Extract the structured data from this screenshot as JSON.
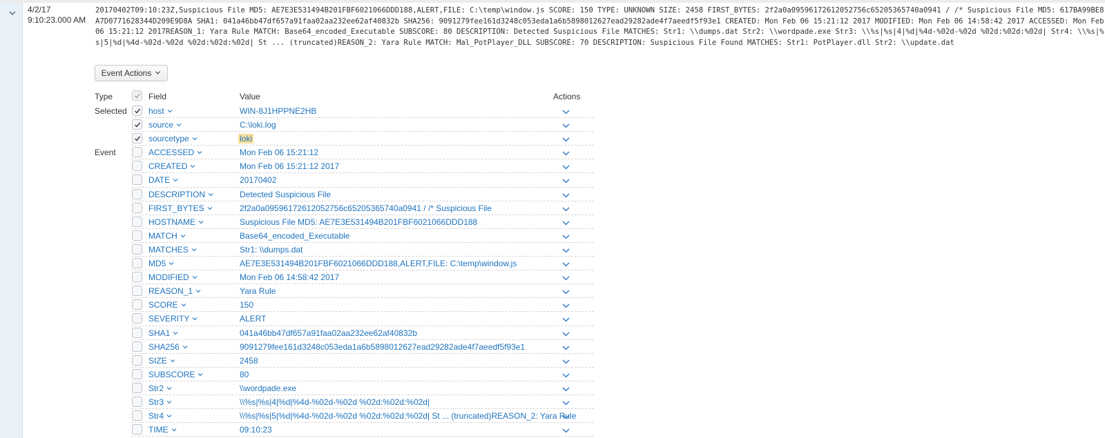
{
  "event": {
    "date": "4/2/17",
    "time": "9:10:23.000 AM",
    "raw": "20170402T09:10:23Z,Suspicious File MD5: AE7E3E531494B201FBF6021066DDD188,ALERT,FILE: C:\\temp\\window.js SCORE: 150 TYPE: UNKNOWN SIZE: 2458 FIRST_BYTES: 2f2a0a09596172612052756c65205365740a0941 / /* Suspicious File MD5: 617BA99BE8A7D0771628344D209E9D8A SHA1: 041a46bb47df657a91faa02aa232ee62af40832b SHA256: 9091279fee161d3248c053eda1a6b5898012627ead29282ade4f7aeedf5f93e1 CREATED: Mon Feb 06 15:21:12 2017 MODIFIED: Mon Feb 06 14:58:42 2017 ACCESSED: Mon Feb 06 15:21:12 2017REASON_1: Yara Rule MATCH: Base64_encoded_Executable SUBSCORE: 80 DESCRIPTION: Detected Suspicious File MATCHES: Str1: \\\\dumps.dat Str2: \\\\wordpade.exe Str3: \\\\%s|%s|4|%d|%4d-%02d-%02d %02d:%02d:%02d| Str4: \\\\%s|%s|5|%d|%4d-%02d-%02d %02d:%02d:%02d| St ... (truncated)REASON_2: Yara Rule MATCH: Mal_PotPlayer_DLL SUBSCORE: 70 DESCRIPTION: Suspicious File Found MATCHES: Str1: PotPlayer.dll Str2: \\\\update.dat"
  },
  "event_actions_label": "Event Actions",
  "table": {
    "headers": {
      "type": "Type",
      "field": "Field",
      "value": "Value",
      "actions": "Actions"
    },
    "rows": [
      {
        "group": "Selected",
        "field": "host",
        "value": "WIN-8J1HPPNE2HB",
        "checked": true,
        "highlight": false
      },
      {
        "group": "",
        "field": "source",
        "value": "C:\\loki.log",
        "checked": true,
        "highlight": false
      },
      {
        "group": "",
        "field": "sourcetype",
        "value": "loki",
        "checked": true,
        "highlight": true
      },
      {
        "group": "Event",
        "field": "ACCESSED",
        "value": "Mon Feb 06 15:21:12",
        "checked": false,
        "highlight": false
      },
      {
        "group": "",
        "field": "CREATED",
        "value": "Mon Feb 06 15:21:12 2017",
        "checked": false,
        "highlight": false
      },
      {
        "group": "",
        "field": "DATE",
        "value": "20170402",
        "checked": false,
        "highlight": false
      },
      {
        "group": "",
        "field": "DESCRIPTION",
        "value": "Detected Suspicious File",
        "checked": false,
        "highlight": false
      },
      {
        "group": "",
        "field": "FIRST_BYTES",
        "value": "2f2a0a09596172612052756c65205365740a0941 / /* Suspicious File",
        "checked": false,
        "highlight": false
      },
      {
        "group": "",
        "field": "HOSTNAME",
        "value": "Suspicious File MD5: AE7E3E531494B201FBF6021066DDD188",
        "checked": false,
        "highlight": false
      },
      {
        "group": "",
        "field": "MATCH",
        "value": "Base64_encoded_Executable",
        "checked": false,
        "highlight": false
      },
      {
        "group": "",
        "field": "MATCHES",
        "value": "Str1: \\\\dumps.dat",
        "checked": false,
        "highlight": false
      },
      {
        "group": "",
        "field": "MD5",
        "value": "AE7E3E531494B201FBF6021066DDD188,ALERT,FILE: C:\\temp\\window.js",
        "checked": false,
        "highlight": false
      },
      {
        "group": "",
        "field": "MODIFIED",
        "value": "Mon Feb 06 14:58:42 2017",
        "checked": false,
        "highlight": false
      },
      {
        "group": "",
        "field": "REASON_1",
        "value": "Yara Rule",
        "checked": false,
        "highlight": false
      },
      {
        "group": "",
        "field": "SCORE",
        "value": "150",
        "checked": false,
        "highlight": false
      },
      {
        "group": "",
        "field": "SEVERITY",
        "value": "ALERT",
        "checked": false,
        "highlight": false
      },
      {
        "group": "",
        "field": "SHA1",
        "value": "041a46bb47df657a91faa02aa232ee62af40832b",
        "checked": false,
        "highlight": false
      },
      {
        "group": "",
        "field": "SHA256",
        "value": "9091279fee161d3248c053eda1a6b5898012627ead29282ade4f7aeedf5f93e1",
        "checked": false,
        "highlight": false
      },
      {
        "group": "",
        "field": "SIZE",
        "value": "2458",
        "checked": false,
        "highlight": false
      },
      {
        "group": "",
        "field": "SUBSCORE",
        "value": "80",
        "checked": false,
        "highlight": false
      },
      {
        "group": "",
        "field": "Str2",
        "value": "\\\\wordpade.exe",
        "checked": false,
        "highlight": false
      },
      {
        "group": "",
        "field": "Str3",
        "value": "\\\\%s|%s|4|%d|%4d-%02d-%02d %02d:%02d:%02d|",
        "checked": false,
        "highlight": false
      },
      {
        "group": "",
        "field": "Str4",
        "value": "\\\\%s|%s|5|%d|%4d-%02d-%02d %02d:%02d:%02d| St ... (truncated)REASON_2: Yara Rule",
        "checked": false,
        "highlight": false
      },
      {
        "group": "",
        "field": "TIME",
        "value": "09:10:23",
        "checked": false,
        "highlight": false
      }
    ]
  }
}
